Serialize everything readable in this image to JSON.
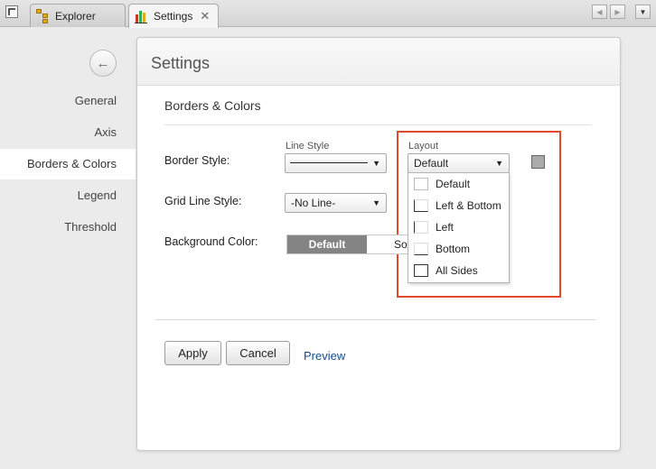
{
  "tabs": [
    {
      "label": "Explorer",
      "icon": "folder-tree-icon"
    },
    {
      "label": "Settings",
      "icon": "bar-chart-icon",
      "close": "✕"
    }
  ],
  "left_nav": {
    "back_icon": "←",
    "items": [
      "General",
      "Axis",
      "Borders & Colors",
      "Legend",
      "Threshold"
    ],
    "active": "Borders & Colors"
  },
  "panel": {
    "title": "Settings",
    "section_title": "Borders & Colors",
    "border_style": {
      "label": "Border Style:",
      "line_style_label": "Line Style",
      "layout_label": "Layout",
      "layout_value": "Default",
      "layout_options": [
        "Default",
        "Left & Bottom",
        "Left",
        "Bottom",
        "All Sides"
      ],
      "color": "#aaaaaa"
    },
    "grid_line_style": {
      "label": "Grid Line Style:",
      "value": "-No Line-"
    },
    "background_color": {
      "label": "Background Color:",
      "option_default": "Default",
      "option_solid": "Solid"
    },
    "buttons": {
      "apply": "Apply",
      "cancel": "Cancel",
      "preview": "Preview"
    }
  },
  "colors": {
    "highlight": "#e04a2a",
    "link": "#1a4b8c",
    "toggle_active": "#848484"
  }
}
